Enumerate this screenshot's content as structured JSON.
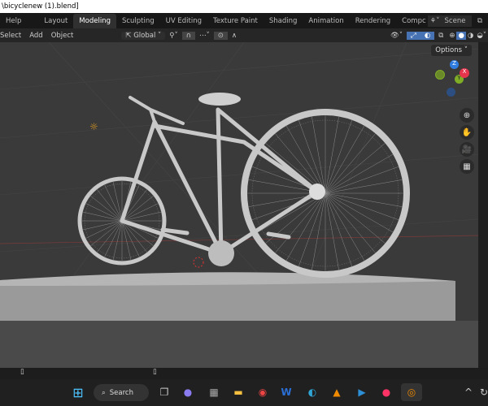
{
  "title": "\\bicyclenew (1).blend]",
  "menu": {
    "help": "Help",
    "tabs": [
      "Layout",
      "Modeling",
      "Sculpting",
      "UV Editing",
      "Texture Paint",
      "Shading",
      "Animation",
      "Rendering",
      "Compc"
    ],
    "active": "Modeling",
    "scene": "Scene"
  },
  "header": {
    "select": "Select",
    "add": "Add",
    "object": "Object",
    "orientation": "Global"
  },
  "viewport": {
    "options": "Options",
    "gizmo": {
      "x": "X",
      "y": "Y",
      "z": "Z"
    }
  },
  "taskbar": {
    "search": "Search",
    "apps": [
      "task-view",
      "chat",
      "calculator",
      "file-explorer",
      "chrome",
      "word",
      "edge",
      "vlc",
      "media-player",
      "firefox",
      "blender"
    ]
  },
  "colors": {
    "x": "#e5344c",
    "y": "#7fad26",
    "z": "#2f7de1",
    "accent": "#4772b3"
  }
}
